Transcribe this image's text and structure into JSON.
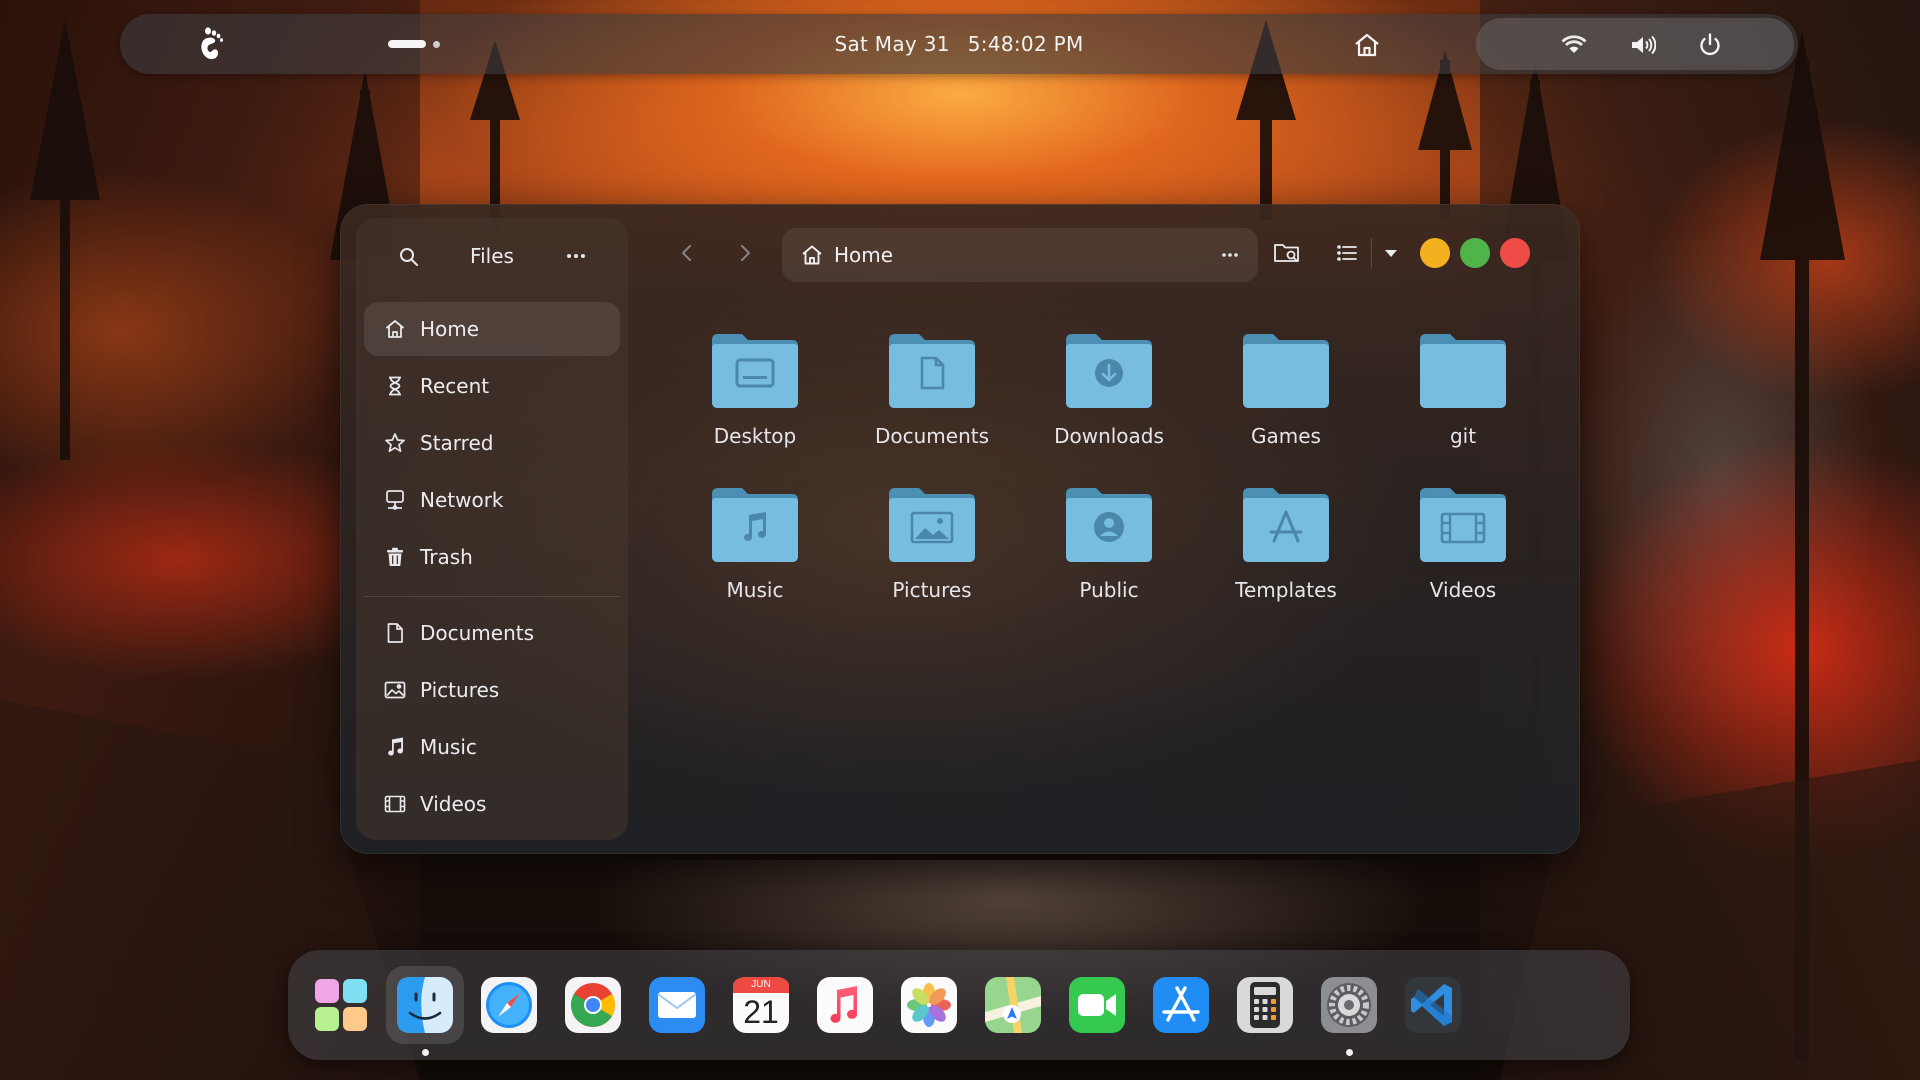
{
  "topbar": {
    "date": "Sat May 31",
    "time": "5:48:02 PM",
    "tray_icons": [
      "wifi-icon",
      "volume-icon",
      "power-icon"
    ]
  },
  "files": {
    "app_title": "Files",
    "sidebar": {
      "places": [
        {
          "label": "Home",
          "icon": "home-icon",
          "active": true
        },
        {
          "label": "Recent",
          "icon": "hourglass-icon"
        },
        {
          "label": "Starred",
          "icon": "star-icon"
        },
        {
          "label": "Network",
          "icon": "network-icon"
        },
        {
          "label": "Trash",
          "icon": "trash-icon"
        }
      ],
      "bookmarks": [
        {
          "label": "Documents",
          "icon": "document-icon"
        },
        {
          "label": "Pictures",
          "icon": "picture-icon"
        },
        {
          "label": "Music",
          "icon": "music-icon"
        },
        {
          "label": "Videos",
          "icon": "video-icon"
        }
      ]
    },
    "path": "Home",
    "folders": [
      {
        "name": "Desktop",
        "emblem": "desktop"
      },
      {
        "name": "Documents",
        "emblem": "document"
      },
      {
        "name": "Downloads",
        "emblem": "download"
      },
      {
        "name": "Games",
        "emblem": "none"
      },
      {
        "name": "git",
        "emblem": "none"
      },
      {
        "name": "Music",
        "emblem": "music"
      },
      {
        "name": "Pictures",
        "emblem": "picture"
      },
      {
        "name": "Public",
        "emblem": "user"
      },
      {
        "name": "Templates",
        "emblem": "template"
      },
      {
        "name": "Videos",
        "emblem": "video"
      }
    ],
    "window_controls": {
      "minimize_color": "#f5b020",
      "maximize_color": "#4fb548",
      "close_color": "#ef4c48"
    }
  },
  "dock": {
    "calendar_month": "JUN",
    "calendar_day": "21",
    "apps": [
      {
        "name": "launchpad",
        "running": false
      },
      {
        "name": "finder",
        "running": true
      },
      {
        "name": "safari",
        "running": false
      },
      {
        "name": "chrome",
        "running": false
      },
      {
        "name": "mail",
        "running": false
      },
      {
        "name": "calendar",
        "running": false
      },
      {
        "name": "music",
        "running": false
      },
      {
        "name": "photos",
        "running": false
      },
      {
        "name": "maps",
        "running": false
      },
      {
        "name": "facetime",
        "running": false
      },
      {
        "name": "app-store",
        "running": false
      },
      {
        "name": "calculator",
        "running": false
      },
      {
        "name": "system-settings",
        "running": true
      },
      {
        "name": "vscode",
        "running": false
      }
    ]
  }
}
